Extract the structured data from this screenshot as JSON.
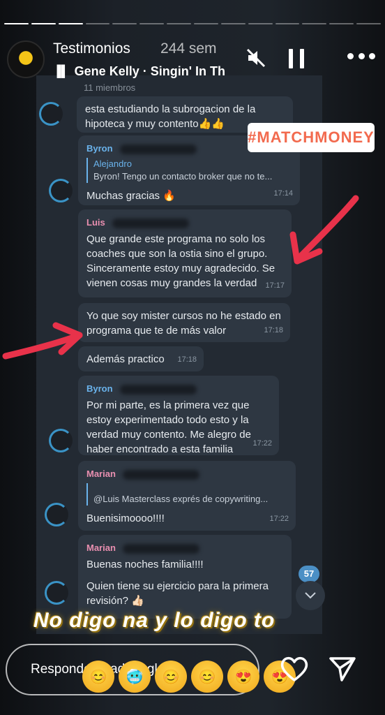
{
  "header": {
    "username": "Testimonios",
    "time": "244 sem",
    "music": "Gene Kelly · Singin' In Th"
  },
  "chat": {
    "ghost_title": "11 miembros",
    "messages": [
      {
        "sender": "",
        "text": "esta estudiando la subrogacion de la hipoteca y muy contento👍👍",
        "time": ""
      },
      {
        "sender": "Byron",
        "reply_name": "Alejandro",
        "reply_text": "Byron! Tengo un contacto broker que no te...",
        "text": "Muchas gracias 🔥",
        "time": "17:14"
      },
      {
        "sender": "Luis",
        "text": "Que grande este programa no solo los coaches que son la ostia sino el grupo. Sinceramente estoy muy agradecido. Se vienen cosas muy grandes la verdad",
        "time": "17:17"
      },
      {
        "sender": "",
        "text": "Yo que soy mister cursos no he estado en programa que te de más valor",
        "time": "17:18"
      },
      {
        "sender": "",
        "text": "Además practico",
        "time": "17:18"
      },
      {
        "sender": "Byron",
        "text": "Por mi parte, es la primera vez que estoy experimentado todo esto y la verdad muy contento. Me alegro de haber encontrado a esta familia",
        "time": "17:22"
      },
      {
        "sender": "Marian",
        "reply_text": "@Luis  Masterclass exprés de copywriting...",
        "text": "Buenisimoooo!!!!",
        "time": "17:22"
      },
      {
        "sender": "Marian",
        "text": "Buenas noches familia!!!!",
        "text2": "Quien tiene su ejercicio para la primera revisión? 👍🏻",
        "time": ""
      }
    ],
    "unread_badge": "57"
  },
  "stickers": {
    "hashtag": "#MATCHMONEY",
    "caption": "No digo na y lo digo to"
  },
  "footer": {
    "reply_placeholder": "Responder a adrianglee...",
    "emojis": [
      "😊",
      "🥶",
      "😊",
      "😊",
      "😍",
      "😍"
    ]
  },
  "colors": {
    "hashtag_text": "#f26a4e",
    "arrow": "#e8324a",
    "sender_blue": "#6ab3ec",
    "sender_pink": "#e98fb0"
  }
}
